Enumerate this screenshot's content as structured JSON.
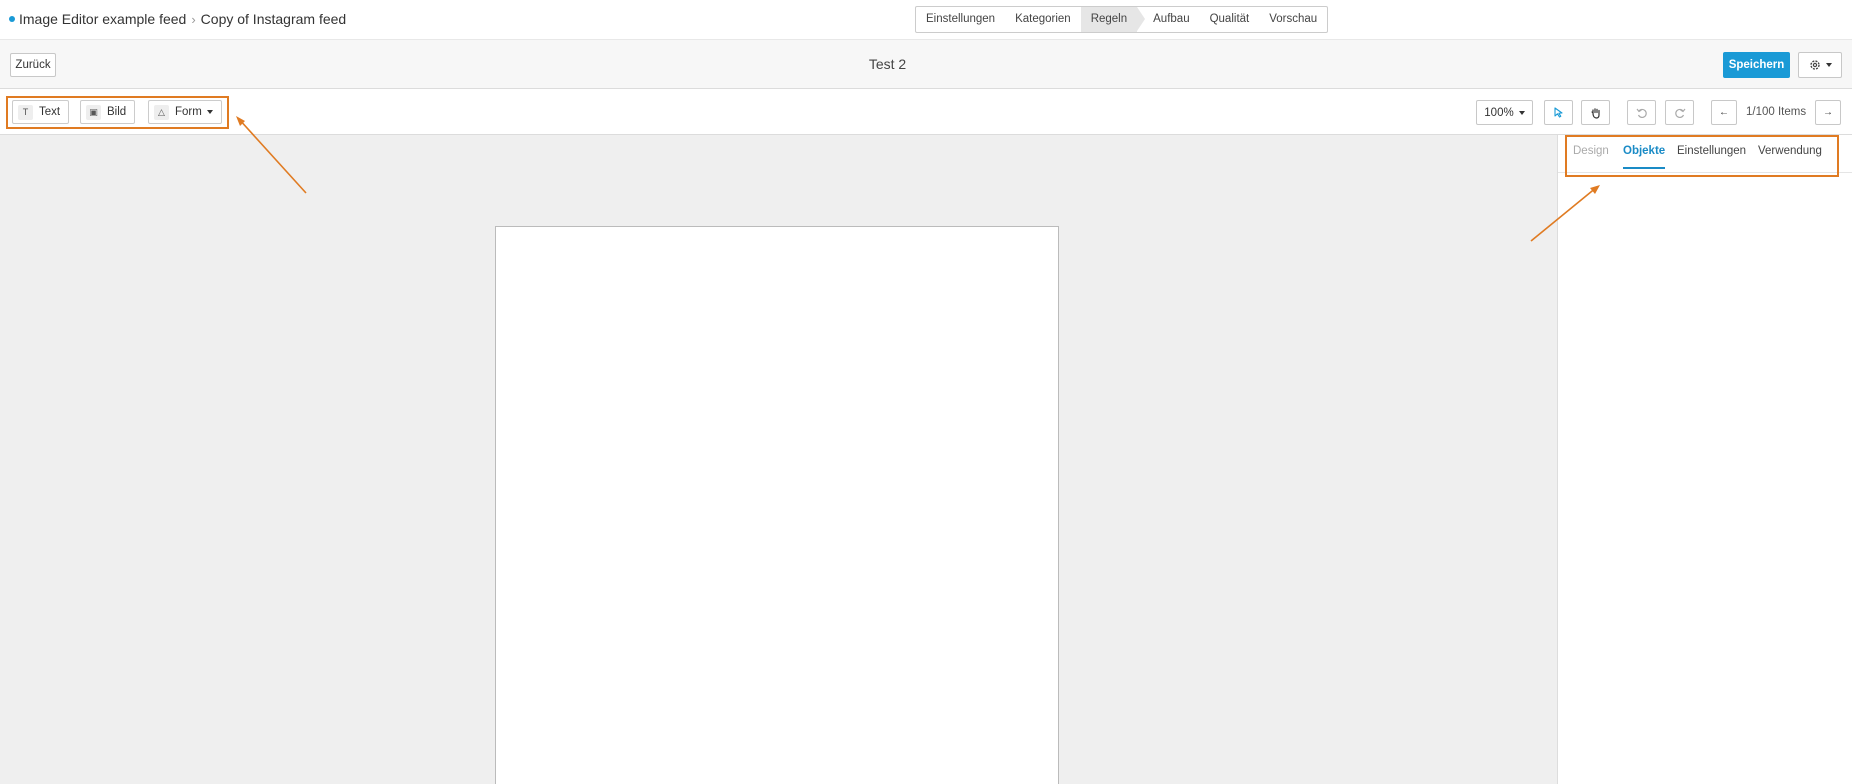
{
  "breadcrumb": {
    "feed": "Image Editor example feed",
    "page": "Copy of Instagram feed"
  },
  "steps": [
    "Einstellungen",
    "Kategorien",
    "Regeln",
    "Aufbau",
    "Qualität",
    "Vorschau"
  ],
  "active_step": "Regeln",
  "header": {
    "back_label": "Zurück",
    "title": "Test 2",
    "save_label": "Speichern"
  },
  "toolbar": {
    "text_label": "Text",
    "image_label": "Bild",
    "shape_label": "Form",
    "zoom": "100%",
    "pager": "1/100 Items"
  },
  "panel": {
    "tabs": [
      "Design",
      "Objekte",
      "Einstellungen",
      "Verwendung"
    ],
    "active_tab": "Objekte"
  },
  "colors": {
    "accent": "#1a9ad6",
    "annotation": "#e07b22",
    "canvas_bg": "#efefef"
  },
  "icons": [
    "text-icon",
    "image-icon",
    "shape-icon",
    "pointer-icon",
    "hand-icon",
    "undo-icon",
    "redo-icon",
    "arrow-left-icon",
    "arrow-right-icon",
    "gear-icon"
  ]
}
